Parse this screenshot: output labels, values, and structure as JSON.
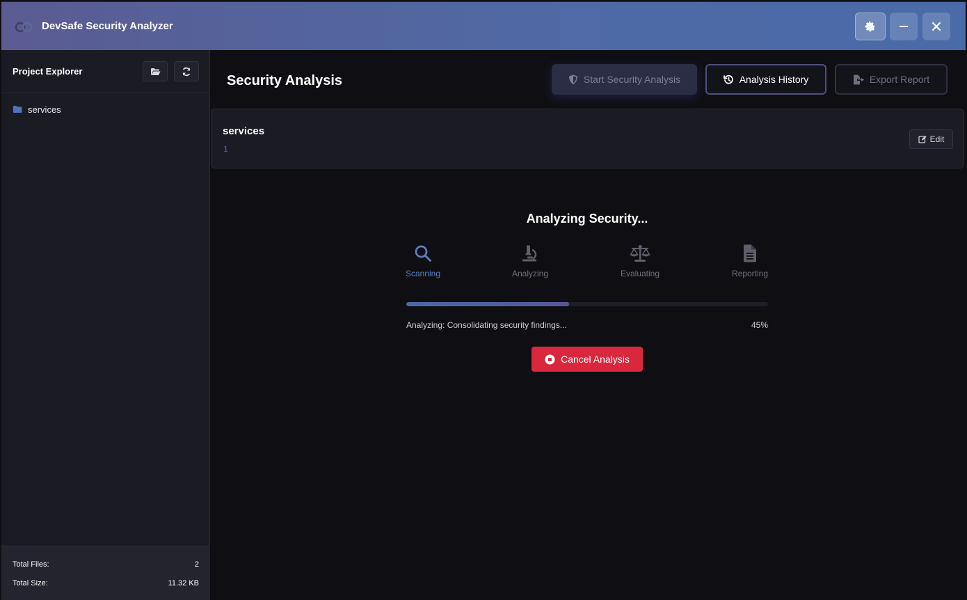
{
  "titlebar": {
    "title": "DevSafe Security Analyzer",
    "buttons": [
      "gear-icon",
      "minus-icon",
      "close-icon"
    ]
  },
  "sidebar": {
    "title": "Project Explorer",
    "tree": [
      {
        "label": "services",
        "icon": "folder-icon"
      }
    ],
    "stats": {
      "total_files_label": "Total Files:",
      "total_files": "2",
      "total_size_label": "Total Size:",
      "total_size": "11.32 KB"
    }
  },
  "main": {
    "title": "Security Analysis",
    "toolbar": {
      "start_label": "Start Security Analysis",
      "history_label": "Analysis History",
      "export_label": "Export Report"
    },
    "file_panel": {
      "name": "services",
      "line_number": "1",
      "edit_label": "Edit"
    },
    "progress": {
      "title": "Analyzing Security...",
      "steps": [
        {
          "label": "Scanning",
          "icon": "search-icon",
          "active": true
        },
        {
          "label": "Analyzing",
          "icon": "microscope-icon",
          "active": false
        },
        {
          "label": "Evaluating",
          "icon": "scale-icon",
          "active": false
        },
        {
          "label": "Reporting",
          "icon": "file-icon",
          "active": false
        }
      ],
      "percent": 45,
      "percent_label": "45%",
      "status": "Analyzing: Consolidating security findings...",
      "cancel_label": "Cancel Analysis"
    }
  },
  "colors": {
    "accent": "#4a6aa8",
    "danger": "#d9283e",
    "background": "#0f0f13",
    "panel": "#1b1b24"
  }
}
